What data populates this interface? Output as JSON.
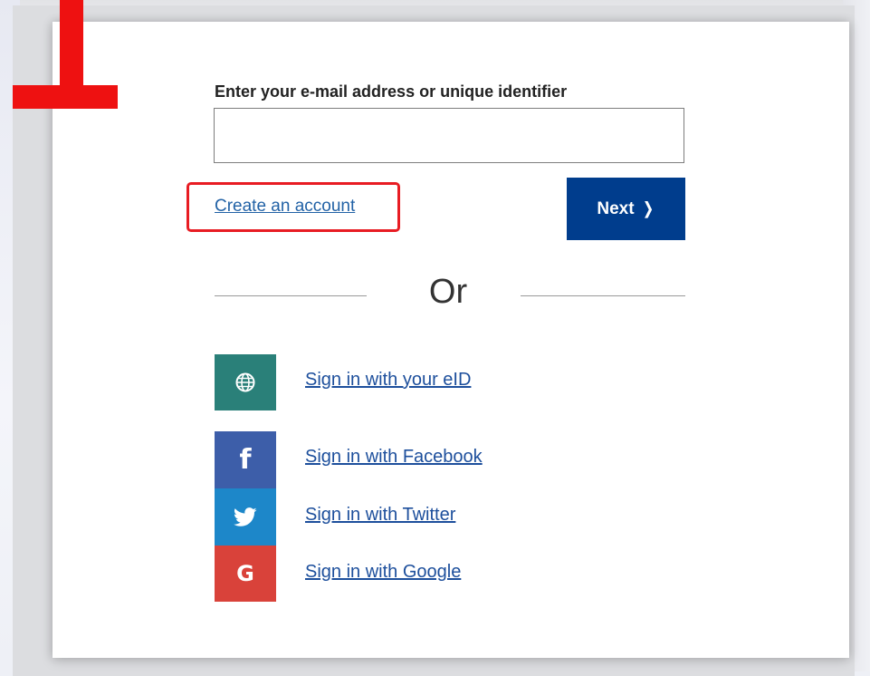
{
  "form": {
    "field_label": "Enter your e-mail address or unique identifier",
    "email_value": "",
    "create_account_label": "Create an account",
    "next_label": "Next",
    "next_chevron": "❭",
    "or_label": "Or"
  },
  "providers": [
    {
      "label": "Sign in with your eID",
      "icon": "globe-icon",
      "color": "#2a8079"
    },
    {
      "label": "Sign in with Facebook",
      "icon": "facebook-icon",
      "glyph": "f",
      "color": "#3d5ea9"
    },
    {
      "label": "Sign in with Twitter",
      "icon": "twitter-icon",
      "color": "#1d87c9"
    },
    {
      "label": "Sign in with Google",
      "icon": "google-icon",
      "glyph": "G",
      "color": "#d9423a"
    }
  ],
  "colors": {
    "brand_blue": "#003d8d",
    "link_blue": "#2262a6",
    "annotation_red": "#e81c23"
  }
}
